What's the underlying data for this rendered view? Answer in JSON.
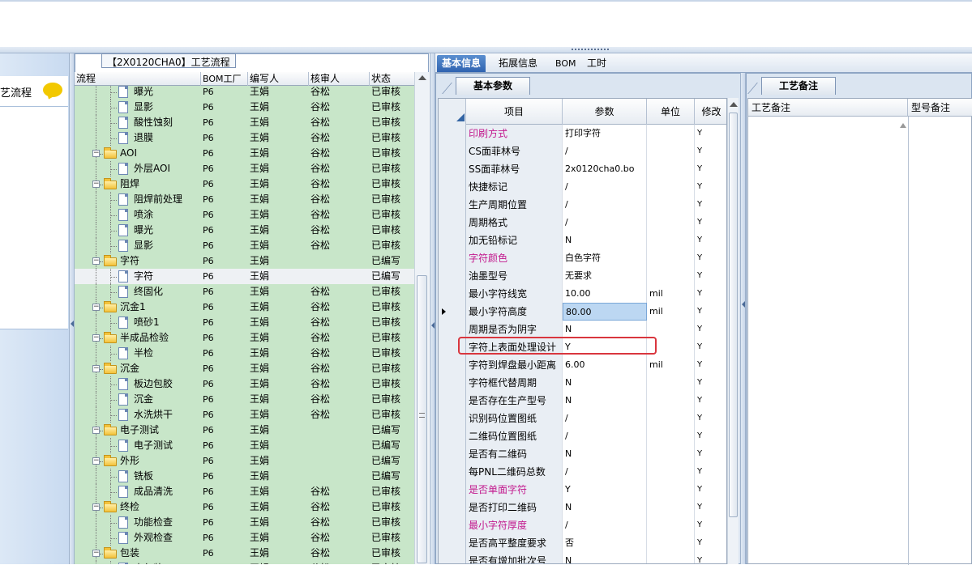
{
  "tree_title": "【2X0120CHA0】工艺流程",
  "nav_label": "艺流程",
  "tree_columns": [
    "流程",
    "BOM工厂",
    "编写人",
    "核审人",
    "状态"
  ],
  "tree_rows": [
    {
      "name": "曝光",
      "kind": "doc",
      "level": 2,
      "bom": "P6",
      "writer": "王娟",
      "reviewer": "谷松",
      "status": "已审核"
    },
    {
      "name": "显影",
      "kind": "doc",
      "level": 2,
      "bom": "P6",
      "writer": "王娟",
      "reviewer": "谷松",
      "status": "已审核"
    },
    {
      "name": "酸性蚀刻",
      "kind": "doc",
      "level": 2,
      "bom": "P6",
      "writer": "王娟",
      "reviewer": "谷松",
      "status": "已审核"
    },
    {
      "name": "退膜",
      "kind": "doc",
      "level": 2,
      "bom": "P6",
      "writer": "王娟",
      "reviewer": "谷松",
      "status": "已审核"
    },
    {
      "name": "AOI",
      "kind": "folder",
      "level": 1,
      "bom": "P6",
      "writer": "王娟",
      "reviewer": "谷松",
      "status": "已审核"
    },
    {
      "name": "外层AOI",
      "kind": "doc",
      "level": 2,
      "bom": "P6",
      "writer": "王娟",
      "reviewer": "谷松",
      "status": "已审核"
    },
    {
      "name": "阻焊",
      "kind": "folder",
      "level": 1,
      "bom": "P6",
      "writer": "王娟",
      "reviewer": "谷松",
      "status": "已审核"
    },
    {
      "name": "阻焊前处理",
      "kind": "doc",
      "level": 2,
      "bom": "P6",
      "writer": "王娟",
      "reviewer": "谷松",
      "status": "已审核"
    },
    {
      "name": "喷涂",
      "kind": "doc",
      "level": 2,
      "bom": "P6",
      "writer": "王娟",
      "reviewer": "谷松",
      "status": "已审核"
    },
    {
      "name": "曝光",
      "kind": "doc",
      "level": 2,
      "bom": "P6",
      "writer": "王娟",
      "reviewer": "谷松",
      "status": "已审核"
    },
    {
      "name": "显影",
      "kind": "doc",
      "level": 2,
      "bom": "P6",
      "writer": "王娟",
      "reviewer": "谷松",
      "status": "已审核"
    },
    {
      "name": "字符",
      "kind": "folder",
      "level": 1,
      "bom": "P6",
      "writer": "王娟",
      "reviewer": "",
      "status": "已编写"
    },
    {
      "name": "字符",
      "kind": "doc",
      "level": 2,
      "bom": "P6",
      "writer": "王娟",
      "reviewer": "",
      "status": "已编写",
      "selected": true
    },
    {
      "name": "终固化",
      "kind": "doc",
      "level": 2,
      "bom": "P6",
      "writer": "王娟",
      "reviewer": "谷松",
      "status": "已审核"
    },
    {
      "name": "沉金1",
      "kind": "folder",
      "level": 1,
      "bom": "P6",
      "writer": "王娟",
      "reviewer": "谷松",
      "status": "已审核"
    },
    {
      "name": "喷砂1",
      "kind": "doc",
      "level": 2,
      "bom": "P6",
      "writer": "王娟",
      "reviewer": "谷松",
      "status": "已审核"
    },
    {
      "name": "半成品检验",
      "kind": "folder",
      "level": 1,
      "bom": "P6",
      "writer": "王娟",
      "reviewer": "谷松",
      "status": "已审核"
    },
    {
      "name": "半检",
      "kind": "doc",
      "level": 2,
      "bom": "P6",
      "writer": "王娟",
      "reviewer": "谷松",
      "status": "已审核"
    },
    {
      "name": "沉金",
      "kind": "folder",
      "level": 1,
      "bom": "P6",
      "writer": "王娟",
      "reviewer": "谷松",
      "status": "已审核"
    },
    {
      "name": "板边包胶",
      "kind": "doc",
      "level": 2,
      "bom": "P6",
      "writer": "王娟",
      "reviewer": "谷松",
      "status": "已审核"
    },
    {
      "name": "沉金",
      "kind": "doc",
      "level": 2,
      "bom": "P6",
      "writer": "王娟",
      "reviewer": "谷松",
      "status": "已审核"
    },
    {
      "name": "水洗烘干",
      "kind": "doc",
      "level": 2,
      "bom": "P6",
      "writer": "王娟",
      "reviewer": "谷松",
      "status": "已审核"
    },
    {
      "name": "电子测试",
      "kind": "folder",
      "level": 1,
      "bom": "P6",
      "writer": "王娟",
      "reviewer": "",
      "status": "已编写"
    },
    {
      "name": "电子测试",
      "kind": "doc",
      "level": 2,
      "bom": "P6",
      "writer": "王娟",
      "reviewer": "",
      "status": "已编写"
    },
    {
      "name": "外形",
      "kind": "folder",
      "level": 1,
      "bom": "P6",
      "writer": "王娟",
      "reviewer": "",
      "status": "已编写"
    },
    {
      "name": "铣板",
      "kind": "doc",
      "level": 2,
      "bom": "P6",
      "writer": "王娟",
      "reviewer": "",
      "status": "已编写"
    },
    {
      "name": "成品清洗",
      "kind": "doc",
      "level": 2,
      "bom": "P6",
      "writer": "王娟",
      "reviewer": "谷松",
      "status": "已审核"
    },
    {
      "name": "终检",
      "kind": "folder",
      "level": 1,
      "bom": "P6",
      "writer": "王娟",
      "reviewer": "谷松",
      "status": "已审核"
    },
    {
      "name": "功能检查",
      "kind": "doc",
      "level": 2,
      "bom": "P6",
      "writer": "王娟",
      "reviewer": "谷松",
      "status": "已审核"
    },
    {
      "name": "外观检查",
      "kind": "doc",
      "level": 2,
      "bom": "P6",
      "writer": "王娟",
      "reviewer": "谷松",
      "status": "已审核"
    },
    {
      "name": "包装",
      "kind": "folder",
      "level": 1,
      "bom": "P6",
      "writer": "王娟",
      "reviewer": "谷松",
      "status": "已审核"
    },
    {
      "name": "内包装",
      "kind": "doc",
      "level": 2,
      "bom": "P6",
      "writer": "王娟",
      "reviewer": "谷松",
      "status": "已审核"
    }
  ],
  "tabs": [
    "基本信息",
    "拓展信息",
    "BOM",
    "工时"
  ],
  "subtab_basic": "基本参数",
  "subtab_notes": "工艺备注",
  "grid_columns": [
    "项目",
    "参数",
    "单位",
    "修改"
  ],
  "grid_rows": [
    {
      "item": "印刷方式",
      "param": "打印字符",
      "unit": "",
      "mod": "Y",
      "pink": true
    },
    {
      "item": "CS面菲林号",
      "param": "/",
      "unit": "",
      "mod": "Y"
    },
    {
      "item": "SS面菲林号",
      "param": "2x0120cha0.bo",
      "unit": "",
      "mod": "Y"
    },
    {
      "item": "快捷标记",
      "param": "/",
      "unit": "",
      "mod": "Y"
    },
    {
      "item": "生产周期位置",
      "param": "/",
      "unit": "",
      "mod": "Y"
    },
    {
      "item": "周期格式",
      "param": "/",
      "unit": "",
      "mod": "Y"
    },
    {
      "item": "加无铅标记",
      "param": "N",
      "unit": "",
      "mod": "Y"
    },
    {
      "item": "字符颜色",
      "param": "白色字符",
      "unit": "",
      "mod": "Y",
      "pink": true
    },
    {
      "item": "油墨型号",
      "param": "无要求",
      "unit": "",
      "mod": "Y"
    },
    {
      "item": "最小字符线宽",
      "param": "10.00",
      "unit": "mil",
      "mod": "Y"
    },
    {
      "item": "最小字符高度",
      "param": "80.00",
      "unit": "mil",
      "mod": "Y",
      "current": true
    },
    {
      "item": "周期是否为阴字",
      "param": "N",
      "unit": "",
      "mod": "Y"
    },
    {
      "item": "字符上表面处理设计",
      "param": "Y",
      "unit": "",
      "mod": "Y"
    },
    {
      "item": "字符到焊盘最小距离",
      "param": "6.00",
      "unit": "mil",
      "mod": "Y"
    },
    {
      "item": "字符框代替周期",
      "param": "N",
      "unit": "",
      "mod": "Y"
    },
    {
      "item": "是否存在生产型号",
      "param": "N",
      "unit": "",
      "mod": "Y"
    },
    {
      "item": "识别码位置图纸",
      "param": "/",
      "unit": "",
      "mod": "Y"
    },
    {
      "item": "二维码位置图纸",
      "param": "/",
      "unit": "",
      "mod": "Y"
    },
    {
      "item": "是否有二维码",
      "param": "N",
      "unit": "",
      "mod": "Y"
    },
    {
      "item": "每PNL二维码总数",
      "param": "/",
      "unit": "",
      "mod": "Y"
    },
    {
      "item": "是否单面字符",
      "param": "Y",
      "unit": "",
      "mod": "Y",
      "pink": true
    },
    {
      "item": "是否打印二维码",
      "param": "N",
      "unit": "",
      "mod": "Y"
    },
    {
      "item": "最小字符厚度",
      "param": "/",
      "unit": "",
      "mod": "Y",
      "pink": true
    },
    {
      "item": "是否高平整度要求",
      "param": "否",
      "unit": "",
      "mod": "Y"
    },
    {
      "item": "是否有增加批次号",
      "param": "N",
      "unit": "",
      "mod": "Y"
    }
  ],
  "note_columns": [
    "工艺备注",
    "型号备注"
  ]
}
